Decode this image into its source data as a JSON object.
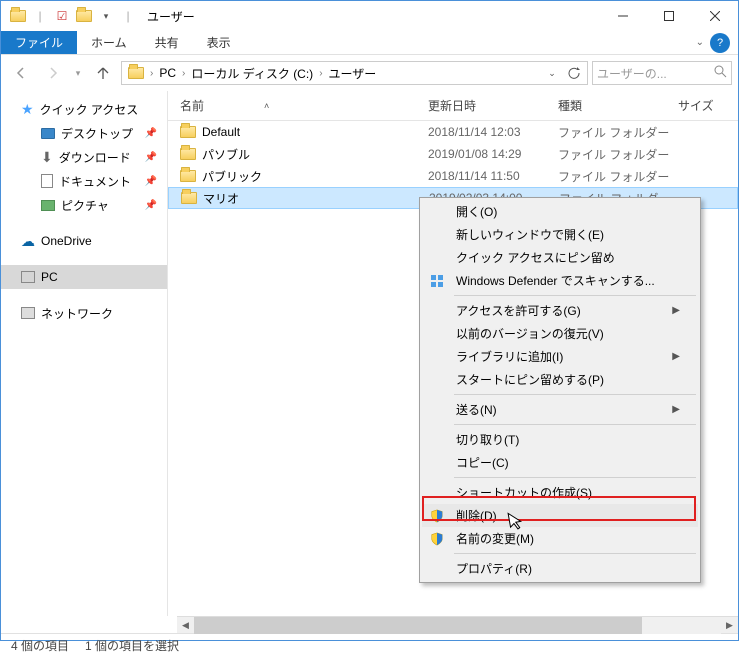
{
  "window": {
    "title": "ユーザー"
  },
  "ribbon": {
    "file": "ファイル",
    "home": "ホーム",
    "share": "共有",
    "view": "表示"
  },
  "breadcrumbs": [
    "PC",
    "ローカル ディスク (C:)",
    "ユーザー"
  ],
  "search": {
    "placeholder": "ユーザーの..."
  },
  "columns": {
    "name": "名前",
    "modified": "更新日時",
    "type": "種類",
    "size": "サイズ"
  },
  "sidebar": {
    "quick": "クイック アクセス",
    "desktop": "デスクトップ",
    "downloads": "ダウンロード",
    "documents": "ドキュメント",
    "pictures": "ピクチャ",
    "onedrive": "OneDrive",
    "pc": "PC",
    "network": "ネットワーク"
  },
  "rows": [
    {
      "name": "Default",
      "date": "2018/11/14 12:03",
      "type": "ファイル フォルダー"
    },
    {
      "name": "パソブル",
      "date": "2019/01/08 14:29",
      "type": "ファイル フォルダー"
    },
    {
      "name": "パブリック",
      "date": "2018/11/14 11:50",
      "type": "ファイル フォルダー"
    },
    {
      "name": "マリオ",
      "date": "2019/02/03 14:00",
      "type": "ファイル フォルダー"
    }
  ],
  "context": {
    "open": "開く(O)",
    "open_new": "新しいウィンドウで開く(E)",
    "pin_quick": "クイック アクセスにピン留め",
    "defender": "Windows Defender でスキャンする...",
    "access": "アクセスを許可する(G)",
    "restore_prev": "以前のバージョンの復元(V)",
    "add_library": "ライブラリに追加(I)",
    "pin_start": "スタートにピン留めする(P)",
    "send_to": "送る(N)",
    "cut": "切り取り(T)",
    "copy": "コピー(C)",
    "shortcut": "ショートカットの作成(S)",
    "delete": "削除(D)",
    "rename": "名前の変更(M)",
    "properties": "プロパティ(R)"
  },
  "status": {
    "count": "4 個の項目",
    "selected": "1 個の項目を選択"
  }
}
